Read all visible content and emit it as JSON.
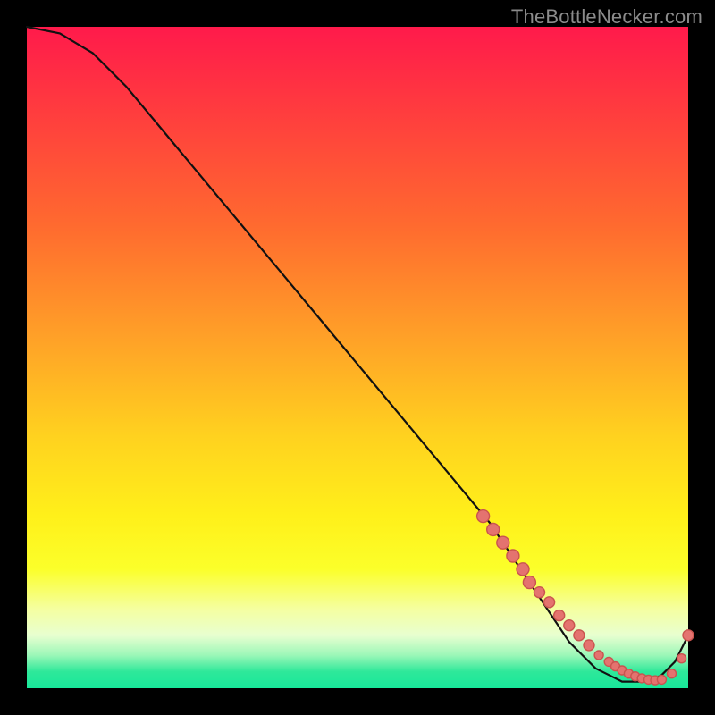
{
  "watermark": "TheBottleNecker.com",
  "colors": {
    "dot_fill": "#e4736f",
    "dot_stroke": "#c9544f",
    "curve": "#111111"
  },
  "chart_data": {
    "type": "line",
    "title": "",
    "xlabel": "",
    "ylabel": "",
    "xlim": [
      0,
      100
    ],
    "ylim": [
      0,
      100
    ],
    "grid": false,
    "legend": null,
    "series": [
      {
        "name": "bottleneck-curve",
        "x": [
          0,
          5,
          10,
          15,
          20,
          25,
          30,
          35,
          40,
          45,
          50,
          55,
          60,
          65,
          70,
          72,
          74,
          76,
          78,
          80,
          82,
          84,
          86,
          88,
          90,
          92,
          94,
          96,
          98,
          100
        ],
        "values": [
          100,
          99,
          96,
          91,
          85,
          79,
          73,
          67,
          61,
          55,
          49,
          43,
          37,
          31,
          25,
          22,
          19,
          16,
          13,
          10,
          7,
          5,
          3,
          2,
          1,
          1,
          1,
          2,
          4,
          8
        ]
      }
    ],
    "highlight_points": {
      "comment": "Salmon dots clustered along the low-right portion of the curve where bottleneck is lowest.",
      "x": [
        69,
        70.5,
        72,
        73.5,
        75,
        76,
        77.5,
        79,
        80.5,
        82,
        83.5,
        85,
        86.5,
        88,
        89,
        90,
        91,
        92,
        93,
        94,
        95,
        96,
        97.5,
        99,
        100
      ],
      "values": [
        26,
        24,
        22,
        20,
        18,
        16,
        14.5,
        13,
        11,
        9.5,
        8,
        6.5,
        5,
        4,
        3.3,
        2.7,
        2.2,
        1.8,
        1.5,
        1.3,
        1.2,
        1.3,
        2.2,
        4.5,
        8
      ]
    }
  }
}
